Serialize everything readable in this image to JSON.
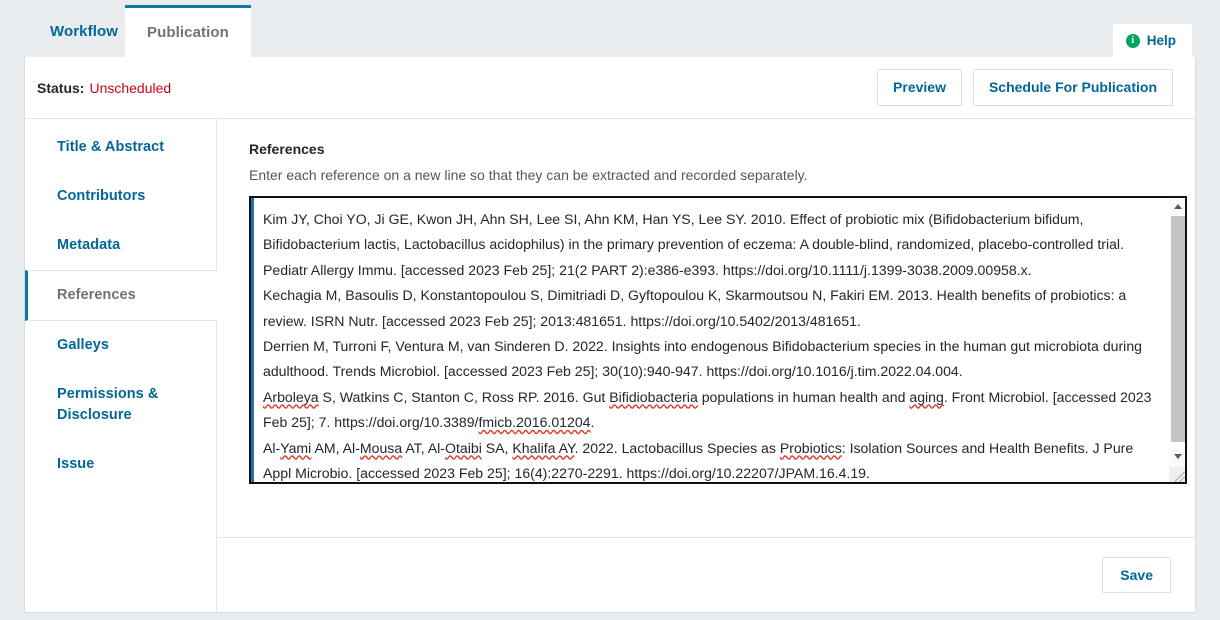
{
  "tabs": [
    {
      "label": "Workflow",
      "active": false
    },
    {
      "label": "Publication",
      "active": true
    }
  ],
  "help": {
    "label": "Help",
    "icon": "info-icon",
    "icon_glyph": "i",
    "icon_color": "#00a65a"
  },
  "status": {
    "label": "Status:",
    "value": "Unscheduled",
    "value_color": "#d0021b"
  },
  "actions": {
    "preview_label": "Preview",
    "schedule_label": "Schedule For Publication",
    "save_label": "Save"
  },
  "sidebar": {
    "items": [
      {
        "label": "Title & Abstract",
        "active": false
      },
      {
        "label": "Contributors",
        "active": false
      },
      {
        "label": "Metadata",
        "active": false
      },
      {
        "label": "References",
        "active": true
      },
      {
        "label": "Galleys",
        "active": false
      },
      {
        "label": "Permissions & Disclosure",
        "active": false
      },
      {
        "label": "Issue",
        "active": false
      }
    ]
  },
  "main": {
    "field_label": "References",
    "field_description": "Enter each reference on a new line so that they can be extracted and recorded separately.",
    "references_value": "Kim JY, Choi YO, Ji GE, Kwon JH, Ahn SH, Lee SI, Ahn KM, Han YS, Lee SY. 2010. Effect of probiotic mix (Bifidobacterium bifidum, Bifidobacterium lactis, Lactobacillus acidophilus) in the primary prevention of eczema: A double-blind, randomized, placebo-controlled trial. Pediatr Allergy Immu. [accessed 2023 Feb 25]; 21(2 PART 2):e386-e393. https://doi.org/10.1111/j.1399-3038.2009.00958.x.\nKechagia M, Basoulis D, Konstantopoulou S, Dimitriadi D, Gyftopoulou K, Skarmoutsou N, Fakiri EM. 2013. Health benefits of probiotics: a review. ISRN Nutr. [accessed 2023 Feb 25]; 2013:481651. https://doi.org/10.5402/2013/481651.\nDerrien M, Turroni F, Ventura M, van Sinderen D. 2022. Insights into endogenous Bifidobacterium species in the human gut microbiota during adulthood. Trends Microbiol. [accessed 2023 Feb 25]; 30(10):940-947. https://doi.org/10.1016/j.tim.2022.04.004.\nArboleya S, Watkins C, Stanton C, Ross RP. 2016. Gut Bifidiobacteria populations in human health and aging. Front Microbiol. [accessed 2023 Feb 25]; 7. https://doi.org/10.3389/fmicb.2016.01204.\nAl-Yami AM, Al-Mousa AT, Al-Otaibi SA, Khalifa AY. 2022. Lactobacillus Species as Probiotics: Isolation Sources and Health Benefits. J Pure Appl Microbio. [accessed 2023 Feb 25]; 16(4):2270-2291. https://doi.org/10.22207/JPAM.16.4.19.",
    "references_lines": [
      {
        "segments": [
          {
            "t": "Kim JY, Choi YO, Ji GE, Kwon JH, Ahn SH, Lee SI, Ahn KM, Han YS, Lee SY. 2010. Effect of probiotic mix (Bifidobacterium bifidum, Bifidobacterium lactis, Lactobacillus acidophilus) in the primary prevention of eczema: A double-blind, randomized, placebo-controlled trial. Pediatr Allergy Immu. [accessed 2023 Feb 25]; 21(2 PART 2):e386-e393. https://doi.org/10.1111/j.1399-3038.2009.00958.x.",
            "misspelled": false
          }
        ]
      },
      {
        "segments": [
          {
            "t": "Kechagia M, Basoulis D, Konstantopoulou S, Dimitriadi D, Gyftopoulou K, Skarmoutsou N, Fakiri EM. 2013. Health benefits of probiotics: a review. ISRN Nutr. [accessed 2023 Feb 25]; 2013:481651. https://doi.org/10.5402/2013/481651.",
            "misspelled": false
          }
        ]
      },
      {
        "segments": [
          {
            "t": "Derrien M, Turroni F, Ventura M, van Sinderen D. 2022. Insights into endogenous Bifidobacterium species in the human gut microbiota during adulthood. Trends Microbiol. [accessed 2023 Feb 25]; 30(10):940-947. https://doi.org/10.1016/j.tim.2022.04.004.",
            "misspelled": false
          }
        ]
      },
      {
        "segments": [
          {
            "t": "Arboleya",
            "misspelled": true
          },
          {
            "t": " S, Watkins C, Stanton C, Ross RP. 2016. Gut ",
            "misspelled": false
          },
          {
            "t": "Bifidiobacteria",
            "misspelled": true
          },
          {
            "t": " populations in human health and ",
            "misspelled": false
          },
          {
            "t": "aging",
            "misspelled": true
          },
          {
            "t": ". Front Microbiol. [accessed 2023 Feb 25]; 7. https://doi.org/10.3389/",
            "misspelled": false
          },
          {
            "t": "fmicb.2016.01204",
            "misspelled": true
          },
          {
            "t": ".",
            "misspelled": false
          }
        ]
      },
      {
        "segments": [
          {
            "t": "Al-",
            "misspelled": false
          },
          {
            "t": "Yami",
            "misspelled": true
          },
          {
            "t": " AM, Al-",
            "misspelled": false
          },
          {
            "t": "Mousa",
            "misspelled": true
          },
          {
            "t": " AT, Al-",
            "misspelled": false
          },
          {
            "t": "Otaibi",
            "misspelled": true
          },
          {
            "t": " SA, ",
            "misspelled": false
          },
          {
            "t": "Khalifa AY",
            "misspelled": true
          },
          {
            "t": ". 2022. Lactobacillus Species as ",
            "misspelled": false
          },
          {
            "t": "Probiotics",
            "misspelled": true
          },
          {
            "t": ": Isolation Sources and Health Benefits. J Pure Appl Microbio. [accessed 2023 Feb 25]; 16(4):2270-2291. https://doi.org/10.22207/JPAM.16.4.19.",
            "misspelled": false
          }
        ]
      }
    ]
  },
  "colors": {
    "link_blue": "#006798",
    "accent_blue": "#0b78a8",
    "status_red": "#d0021b",
    "help_green": "#00a65a",
    "spellcheck_red": "#e2392e",
    "page_bg": "#e9edef"
  }
}
